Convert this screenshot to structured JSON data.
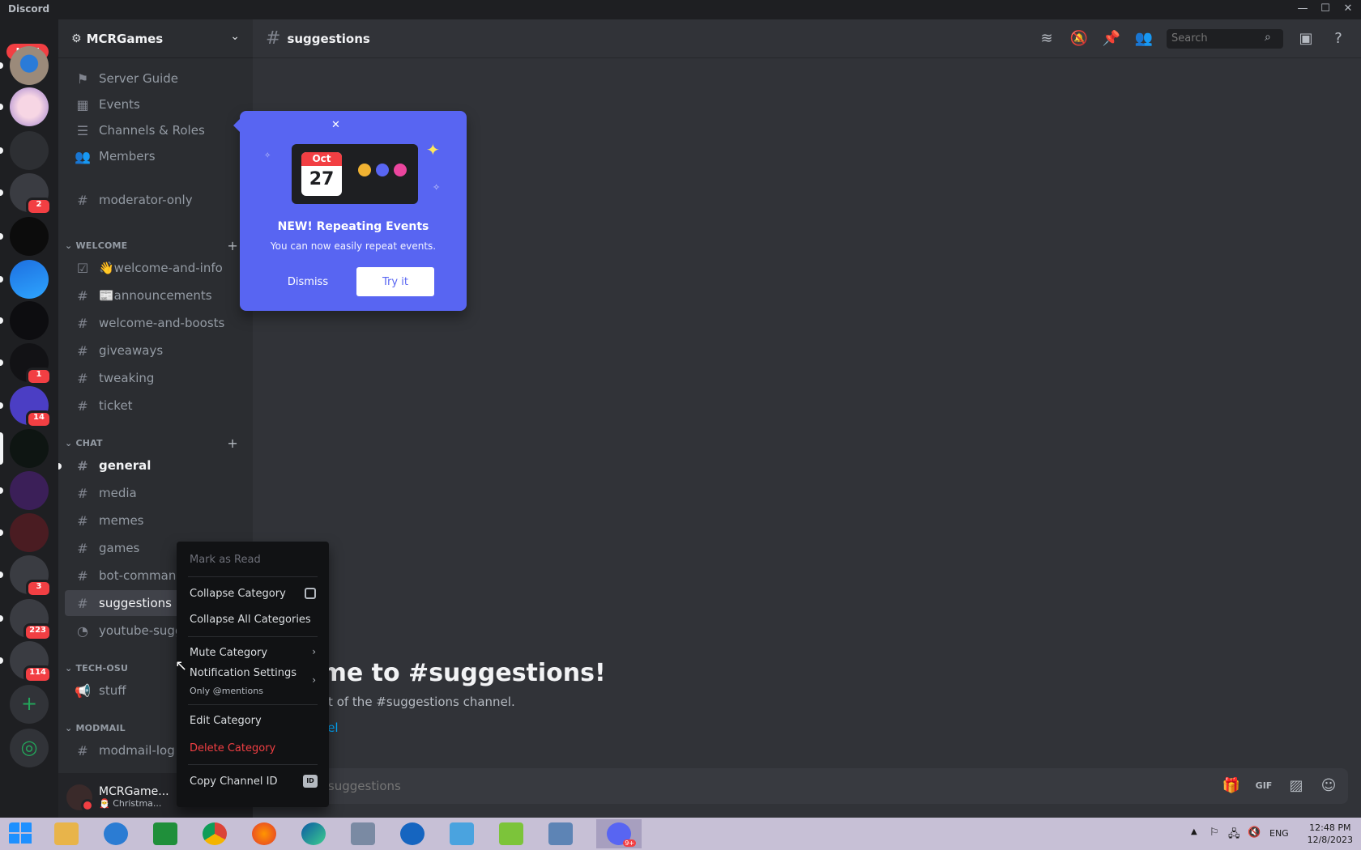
{
  "window": {
    "title": "Discord",
    "minimize": "—",
    "maximize": "☐",
    "close": "✕"
  },
  "rail": {
    "new_badge": "NEW",
    "badges": {
      "gsy": "2",
      "cbs": "1",
      "s14": "14",
      "s3": "3",
      "s223": "223",
      "s114": "114"
    },
    "add_server": "+",
    "discover": "◎"
  },
  "server": {
    "name": "MCRGames"
  },
  "nav": {
    "server_guide": "Server Guide",
    "events": "Events",
    "channels_roles": "Channels & Roles",
    "members": "Members",
    "moderator_only": "moderator-only"
  },
  "categories": {
    "welcome": "WELCOME",
    "chat": "CHAT",
    "tech_osu": "TECH-OSU",
    "modmail": "MODMAIL"
  },
  "channels": {
    "welcome_and_info": "👋welcome-and-info",
    "announcements": "📰announcements",
    "welcome_and_boosts": "welcome-and-boosts",
    "giveaways": "giveaways",
    "tweaking": "tweaking",
    "ticket": "ticket",
    "general": "general",
    "media": "media",
    "memes": "memes",
    "games": "games",
    "bot_commands": "bot-commands",
    "suggestions": "suggestions",
    "youtube": "youtube-sugge",
    "stuff": "stuff",
    "modmail_log": "modmail-log"
  },
  "user": {
    "name": "MCRGame...",
    "status": "🎅 Christma..."
  },
  "header": {
    "channel": "suggestions",
    "search_placeholder": "Search"
  },
  "popover": {
    "month": "Oct",
    "day": "27",
    "title": "NEW! Repeating Events",
    "description": "You can now easily repeat events.",
    "dismiss": "Dismiss",
    "try_it": "Try it"
  },
  "welcome": {
    "title": "ome to #suggestions!",
    "subtitle": "start of the #suggestions channel.",
    "link": "annel"
  },
  "composer": {
    "placeholder": "ssage #suggestions"
  },
  "context_menu": {
    "mark_read": "Mark as Read",
    "collapse_category": "Collapse Category",
    "collapse_all": "Collapse All Categories",
    "mute_category": "Mute Category",
    "notification_settings": "Notification Settings",
    "notification_sub": "Only @mentions",
    "edit_category": "Edit Category",
    "delete_category": "Delete Category",
    "copy_channel_id": "Copy Channel ID",
    "id_badge": "ID"
  },
  "taskbar": {
    "lang": "ENG",
    "time": "12:48 PM",
    "date": "12/8/2023",
    "discord_badge": "9+"
  },
  "colors": {
    "blurple": "#5865f2",
    "danger": "#f23f43",
    "link": "#00a8fc"
  }
}
